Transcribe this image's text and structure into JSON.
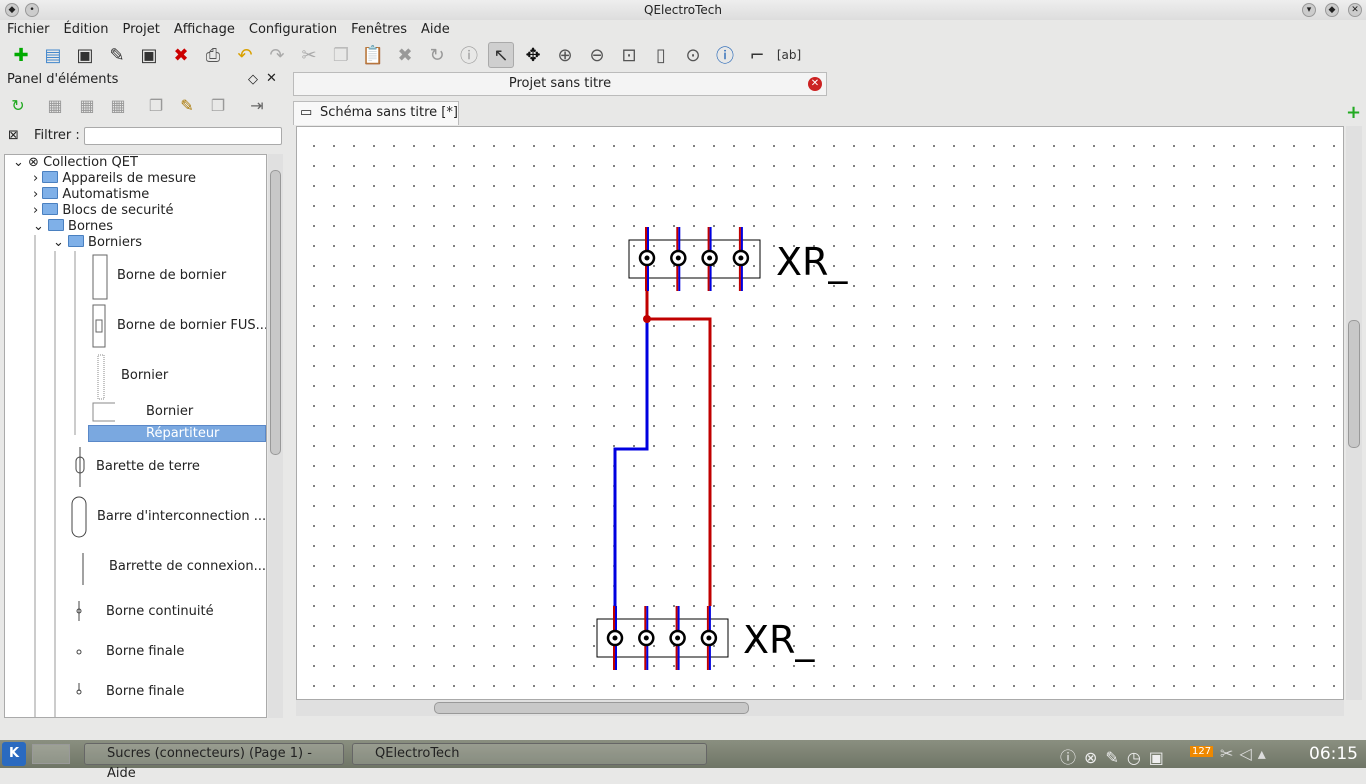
{
  "window": {
    "title": "QElectroTech"
  },
  "menu": [
    "Fichier",
    "Édition",
    "Projet",
    "Affichage",
    "Configuration",
    "Fenêtres",
    "Aide"
  ],
  "toolbar": [
    "new-file",
    "open",
    "save",
    "save-as",
    "save-all",
    "close",
    "print",
    "undo",
    "redo",
    "cut",
    "copy",
    "paste",
    "delete",
    "rotate",
    "info",
    "select",
    "move",
    "zoom-in",
    "zoom-out",
    "zoom-fit",
    "zoom-reset",
    "zoom-1-1",
    "about",
    "conductor",
    "text"
  ],
  "panel": {
    "title": "Panel d'éléments",
    "filter_label": "Filtrer :",
    "filter_value": ""
  },
  "tree": [
    {
      "label": "Collection QET",
      "type": "root"
    },
    {
      "label": "Appareils de mesure",
      "type": "folder"
    },
    {
      "label": "Automatisme",
      "type": "folder"
    },
    {
      "label": "Blocs de securité",
      "type": "folder"
    },
    {
      "label": "Bornes",
      "type": "folder"
    },
    {
      "label": "Borniers",
      "type": "folder"
    },
    {
      "label": "Borne de bornier"
    },
    {
      "label": "Borne de bornier FUS..."
    },
    {
      "label": "Bornier"
    },
    {
      "label": "Bornier"
    },
    {
      "label": "Répartiteur",
      "selected": true
    },
    {
      "label": "Barette de terre"
    },
    {
      "label": "Barre d'interconnection ..."
    },
    {
      "label": "Barrette de connexion..."
    },
    {
      "label": "Borne continuité"
    },
    {
      "label": "Borne finale"
    },
    {
      "label": "Borne finale"
    }
  ],
  "project_tab": "Projet sans titre",
  "diagram_tab": "Schéma sans titre [*]",
  "diagram": {
    "labels": [
      "XR_",
      "XR_"
    ],
    "colors": {
      "red": "#c00000",
      "blue": "#0000e0"
    }
  },
  "taskbar": {
    "tasks": [
      "Sucres (connecteurs) (Page 1) - Aide",
      "QElectroTech"
    ],
    "clock": "06:15",
    "badge": "127"
  }
}
